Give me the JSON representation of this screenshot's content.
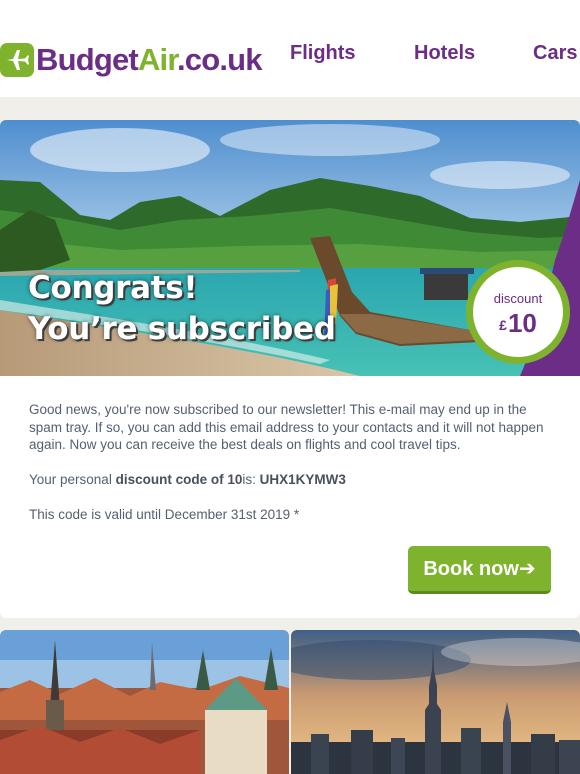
{
  "header": {
    "logo": {
      "part1": "Budget",
      "part2": "Air",
      "part3": ".co.uk",
      "icon": "plane-icon"
    },
    "nav": [
      "Flights",
      "Hotels",
      "Cars"
    ]
  },
  "hero": {
    "title_line1": "Congrats!",
    "title_line2": "You’re subscribed",
    "badge": {
      "label": "discount",
      "currency": "£",
      "amount": "10"
    }
  },
  "body": {
    "p1": "Good news, you're now subscribed to our newsletter! This e-mail may end up in the spam tray. If so, you can add this email address to your contacts and it will not happen again. Now you can receive the best deals on flights and cool travel tips.",
    "p2_prefix": "Your personal ",
    "p2_bold": "discount code of 10",
    "p2_mid": "is: ",
    "p2_code": "UHX1KYMW3",
    "p3": "This code is valid until December 31st 2019 *"
  },
  "cta": {
    "label": "Book now➔"
  },
  "colors": {
    "brand_purple": "#6b2d86",
    "brand_green": "#80b32d",
    "body_text": "#556070"
  }
}
